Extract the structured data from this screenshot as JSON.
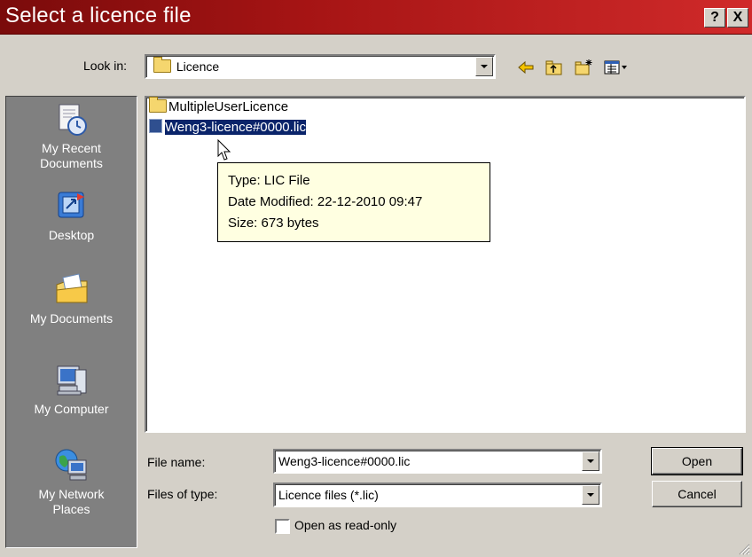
{
  "dialog": {
    "title": "Select a licence file",
    "help_label": "?",
    "close_label": "X"
  },
  "lookin": {
    "label": "Look in:",
    "value": "Licence"
  },
  "toolbar": {
    "icons": [
      "back-icon",
      "up-folder-icon",
      "new-folder-icon",
      "view-menu-icon"
    ]
  },
  "places": [
    {
      "icon": "recent-documents-icon",
      "label_lines": [
        "My Recent",
        "Documents"
      ]
    },
    {
      "icon": "desktop-icon",
      "label_lines": [
        "Desktop"
      ]
    },
    {
      "icon": "my-documents-icon",
      "label_lines": [
        "My Documents"
      ]
    },
    {
      "icon": "my-computer-icon",
      "label_lines": [
        "My Computer"
      ]
    },
    {
      "icon": "network-places-icon",
      "label_lines": [
        "My Network",
        "Places"
      ]
    }
  ],
  "files": [
    {
      "name": "MultipleUserLicence",
      "type": "folder",
      "selected": false
    },
    {
      "name": "Weng3-licence#0000.lic",
      "type": "file",
      "selected": true
    }
  ],
  "tooltip": {
    "type_line": "Type: LIC File",
    "date_line": "Date Modified: 22-12-2010 09:47",
    "size_line": "Size: 673 bytes"
  },
  "filename": {
    "label": "File name:",
    "value": "Weng3-licence#0000.lic"
  },
  "filetype": {
    "label": "Files of type:",
    "value": "Licence files (*.lic)"
  },
  "readonly": {
    "label": "Open as read-only",
    "checked": false
  },
  "buttons": {
    "open": "Open",
    "cancel": "Cancel"
  },
  "colors": {
    "title_bar": "#a51414",
    "selection": "#0a246a",
    "tooltip_bg": "#ffffe1",
    "places_bg": "#808080"
  }
}
